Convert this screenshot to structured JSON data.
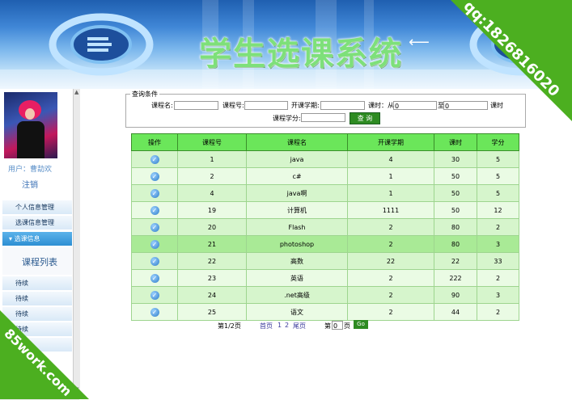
{
  "header": {
    "title": "学生选课系统"
  },
  "watermarks": {
    "top_right": "qq:1826816020",
    "bottom_left": "85work.com"
  },
  "sidebar": {
    "user_line": "用户：曹劼欢",
    "logout": "注销",
    "menu": [
      {
        "label": "个人信息管理"
      },
      {
        "label": "选课信息管理"
      },
      {
        "label": "选课信息",
        "active": true
      }
    ],
    "submenu_label": "课程列表",
    "pending": [
      "待续",
      "待续",
      "待续",
      "待续",
      "待续"
    ]
  },
  "query": {
    "legend": "查询条件",
    "course_name_label": "课程名:",
    "course_no_label": "课程号:",
    "term_label": "开课学期:",
    "hours_label": "课时：从",
    "hours_from": "0",
    "hours_to_label": "至",
    "hours_to": "0",
    "hours_unit": "课时",
    "credit_label": "课程学分:",
    "button": "查 询"
  },
  "table": {
    "headers": [
      "操作",
      "课程号",
      "课程名",
      "开课学期",
      "课时",
      "学分"
    ],
    "rows": [
      {
        "id": "1",
        "name": "java",
        "term": "4",
        "hours": "30",
        "credit": "5"
      },
      {
        "id": "2",
        "name": "c#",
        "term": "1",
        "hours": "50",
        "credit": "5"
      },
      {
        "id": "4",
        "name": "java啊",
        "term": "1",
        "hours": "50",
        "credit": "5"
      },
      {
        "id": "19",
        "name": "计算机",
        "term": "1111",
        "hours": "50",
        "credit": "12"
      },
      {
        "id": "20",
        "name": "Flash",
        "term": "2",
        "hours": "80",
        "credit": "2"
      },
      {
        "id": "21",
        "name": "photoshop",
        "term": "2",
        "hours": "80",
        "credit": "3"
      },
      {
        "id": "22",
        "name": "高数",
        "term": "22",
        "hours": "22",
        "credit": "33"
      },
      {
        "id": "23",
        "name": "英语",
        "term": "2",
        "hours": "222",
        "credit": "2"
      },
      {
        "id": "24",
        "name": ".net高级",
        "term": "2",
        "hours": "90",
        "credit": "3"
      },
      {
        "id": "25",
        "name": "语文",
        "term": "2",
        "hours": "44",
        "credit": "2"
      }
    ]
  },
  "pager": {
    "info": "第1/2页",
    "first": "首页",
    "p1": "1",
    "p2": "2",
    "last": "尾页",
    "goto_prefix": "第",
    "goto_value": "0",
    "goto_suffix": "页",
    "go": "Go"
  }
}
